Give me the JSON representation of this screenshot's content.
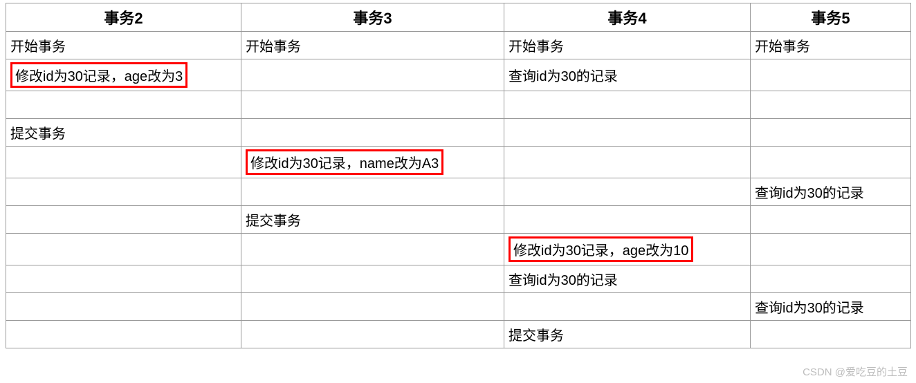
{
  "columns": [
    "事务2",
    "事务3",
    "事务4",
    "事务5"
  ],
  "rows": [
    [
      {
        "text": "开始事务"
      },
      {
        "text": "开始事务"
      },
      {
        "text": "开始事务"
      },
      {
        "text": "开始事务"
      }
    ],
    [
      {
        "text": "修改id为30记录，age改为3",
        "highlight": true
      },
      {
        "text": ""
      },
      {
        "text": "查询id为30的记录"
      },
      {
        "text": ""
      }
    ],
    [
      {
        "text": ""
      },
      {
        "text": ""
      },
      {
        "text": ""
      },
      {
        "text": ""
      }
    ],
    [
      {
        "text": "提交事务"
      },
      {
        "text": ""
      },
      {
        "text": ""
      },
      {
        "text": ""
      }
    ],
    [
      {
        "text": ""
      },
      {
        "text": "修改id为30记录，name改为A3",
        "highlight": true
      },
      {
        "text": ""
      },
      {
        "text": ""
      }
    ],
    [
      {
        "text": ""
      },
      {
        "text": ""
      },
      {
        "text": ""
      },
      {
        "text": "查询id为30的记录"
      }
    ],
    [
      {
        "text": ""
      },
      {
        "text": "提交事务"
      },
      {
        "text": ""
      },
      {
        "text": ""
      }
    ],
    [
      {
        "text": ""
      },
      {
        "text": ""
      },
      {
        "text": "修改id为30记录，age改为10",
        "highlight": true
      },
      {
        "text": ""
      }
    ],
    [
      {
        "text": ""
      },
      {
        "text": ""
      },
      {
        "text": "查询id为30的记录"
      },
      {
        "text": ""
      }
    ],
    [
      {
        "text": ""
      },
      {
        "text": ""
      },
      {
        "text": ""
      },
      {
        "text": "查询id为30的记录"
      }
    ],
    [
      {
        "text": ""
      },
      {
        "text": ""
      },
      {
        "text": "提交事务"
      },
      {
        "text": ""
      }
    ]
  ],
  "watermark": "CSDN @爱吃豆的土豆"
}
